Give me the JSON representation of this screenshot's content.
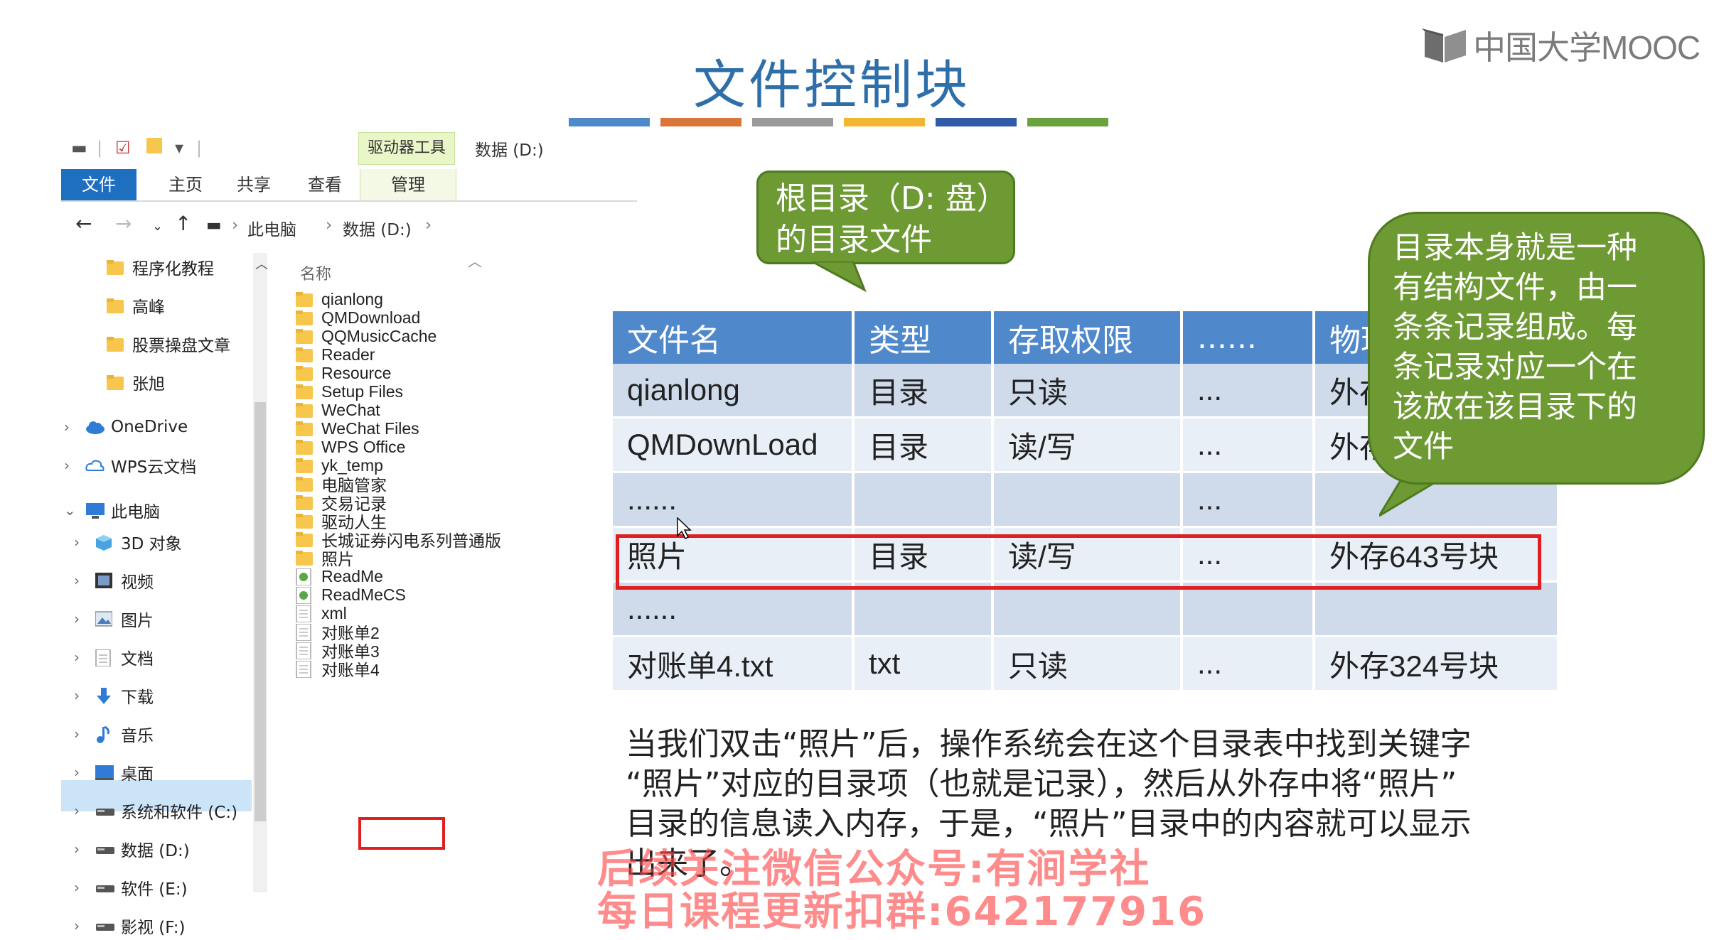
{
  "slide": {
    "title": "文件控制块",
    "bar_colors": [
      "#4e8ac8",
      "#d9763a",
      "#9a9a9a",
      "#f2b631",
      "#2f5aa6",
      "#6aa33e"
    ]
  },
  "logo": {
    "text": "中国大学MOOC"
  },
  "explorer": {
    "drive_tools": "驱动器工具",
    "drive_title": "数据 (D:)",
    "ribbon_tabs": [
      "文件",
      "主页",
      "共享",
      "查看",
      "管理"
    ],
    "address": {
      "pc": "此电脑",
      "drive": "数据 (D:)"
    },
    "column_header": "名称",
    "nav_items": [
      {
        "label": "程序化教程",
        "icon": "folder-icon"
      },
      {
        "label": "高峰",
        "icon": "folder-icon"
      },
      {
        "label": "股票操盘文章",
        "icon": "folder-icon"
      },
      {
        "label": "张旭",
        "icon": "folder-icon"
      },
      {
        "label": "OneDrive",
        "icon": "cloud-icon"
      },
      {
        "label": "WPS云文档",
        "icon": "cloud-outline-icon"
      },
      {
        "label": "此电脑",
        "icon": "computer-icon"
      },
      {
        "label": "3D 对象",
        "icon": "cube-icon"
      },
      {
        "label": "视频",
        "icon": "video-icon"
      },
      {
        "label": "图片",
        "icon": "picture-icon"
      },
      {
        "label": "文档",
        "icon": "document-icon"
      },
      {
        "label": "下载",
        "icon": "download-icon"
      },
      {
        "label": "音乐",
        "icon": "music-icon"
      },
      {
        "label": "桌面",
        "icon": "desktop-icon"
      },
      {
        "label": "系统和软件 (C:)",
        "icon": "drive-icon"
      },
      {
        "label": "数据 (D:)",
        "icon": "drive-icon"
      },
      {
        "label": "软件 (E:)",
        "icon": "drive-icon"
      },
      {
        "label": "影视 (F:)",
        "icon": "drive-icon"
      }
    ],
    "files": [
      {
        "name": "qianlong",
        "icon": "folder-icon"
      },
      {
        "name": "QMDownload",
        "icon": "folder-icon"
      },
      {
        "name": "QQMusicCache",
        "icon": "folder-icon"
      },
      {
        "name": "Reader",
        "icon": "folder-icon"
      },
      {
        "name": "Resource",
        "icon": "folder-icon"
      },
      {
        "name": "Setup Files",
        "icon": "folder-icon"
      },
      {
        "name": "WeChat",
        "icon": "folder-icon"
      },
      {
        "name": "WeChat Files",
        "icon": "folder-icon"
      },
      {
        "name": "WPS Office",
        "icon": "folder-icon"
      },
      {
        "name": "yk_temp",
        "icon": "folder-icon"
      },
      {
        "name": "电脑管家",
        "icon": "folder-icon"
      },
      {
        "name": "交易记录",
        "icon": "folder-icon"
      },
      {
        "name": "驱动人生",
        "icon": "folder-icon"
      },
      {
        "name": "长城证券闪电系列普通版",
        "icon": "folder-icon"
      },
      {
        "name": "照片",
        "icon": "folder-icon"
      },
      {
        "name": "ReadMe",
        "icon": "app-file-icon"
      },
      {
        "name": "ReadMeCS",
        "icon": "app-file-icon"
      },
      {
        "name": "xml",
        "icon": "text-file-icon"
      },
      {
        "name": "对账单2",
        "icon": "text-file-icon"
      },
      {
        "name": "对账单3",
        "icon": "text-file-icon"
      },
      {
        "name": "对账单4",
        "icon": "text-file-icon"
      }
    ]
  },
  "bubble1": {
    "line1": "根目录（D: 盘）",
    "line2": "的目录文件"
  },
  "bubble2": {
    "lines": [
      "目录本身就是一种",
      "有结构文件，由一",
      "条条记录组成。每",
      "条记录对应一个在",
      "该放在该目录下的",
      "文件"
    ]
  },
  "table": {
    "headers": [
      "文件名",
      "类型",
      "存取权限",
      "......",
      "物理位置"
    ],
    "rows": [
      [
        "qianlong",
        "目录",
        "只读",
        "...",
        "外存"
      ],
      [
        "QMDownLoad",
        "目录",
        "读/写",
        "...",
        "外存"
      ],
      [
        "......",
        "",
        "",
        "...",
        ""
      ],
      [
        "照片",
        "目录",
        "读/写",
        "...",
        "外存643号块"
      ],
      [
        "......",
        "",
        "",
        "",
        ""
      ],
      [
        "对账单4.txt",
        "txt",
        "只读",
        "...",
        "外存324号块"
      ]
    ]
  },
  "paragraph": {
    "lines": [
      "当我们双击“照片”后，操作系统会在这个目录表中找到关键字",
      "“照片”对应的目录项（也就是记录），然后从外存中将“照片”",
      "目录的信息读入内存，于是，“照片”目录中的内容就可以显示",
      "出来了。"
    ]
  },
  "watermark": {
    "line1": "后续关注微信公众号:有涧学社",
    "line2": "每日课程更新扣群:642177916"
  }
}
